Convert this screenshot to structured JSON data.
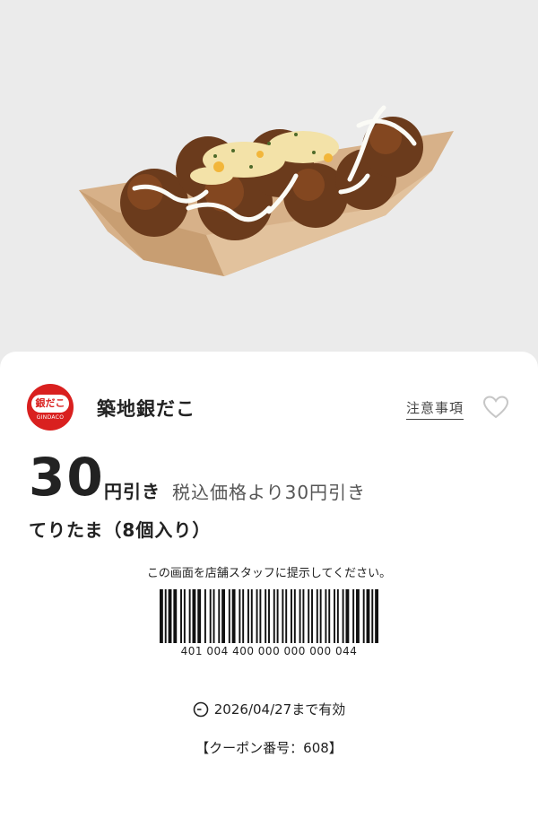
{
  "product_image": {
    "icon": "takoyaki-photo"
  },
  "store": {
    "logo_text": "銀だこ",
    "logo_subtext": "GINDACO",
    "name": "築地銀だこ"
  },
  "header": {
    "notes_label": "注意事項",
    "favorite_icon": "heart-outline-icon"
  },
  "discount": {
    "amount": "30",
    "unit": "円引き",
    "description": "税込価格より30円引き"
  },
  "product": {
    "name": "てりたま（8個入り）"
  },
  "barcode": {
    "instruction": "この画面を店舗スタッフに提示してください。",
    "number": "401 004 400 000 000 000 044"
  },
  "validity": {
    "icon": "clock-icon",
    "text": "2026/04/27まで有効"
  },
  "coupon": {
    "number_text": "【クーポン番号：608】"
  },
  "colors": {
    "brand_red": "#d9201f",
    "background": "#ebebeb",
    "card": "#ffffff"
  }
}
